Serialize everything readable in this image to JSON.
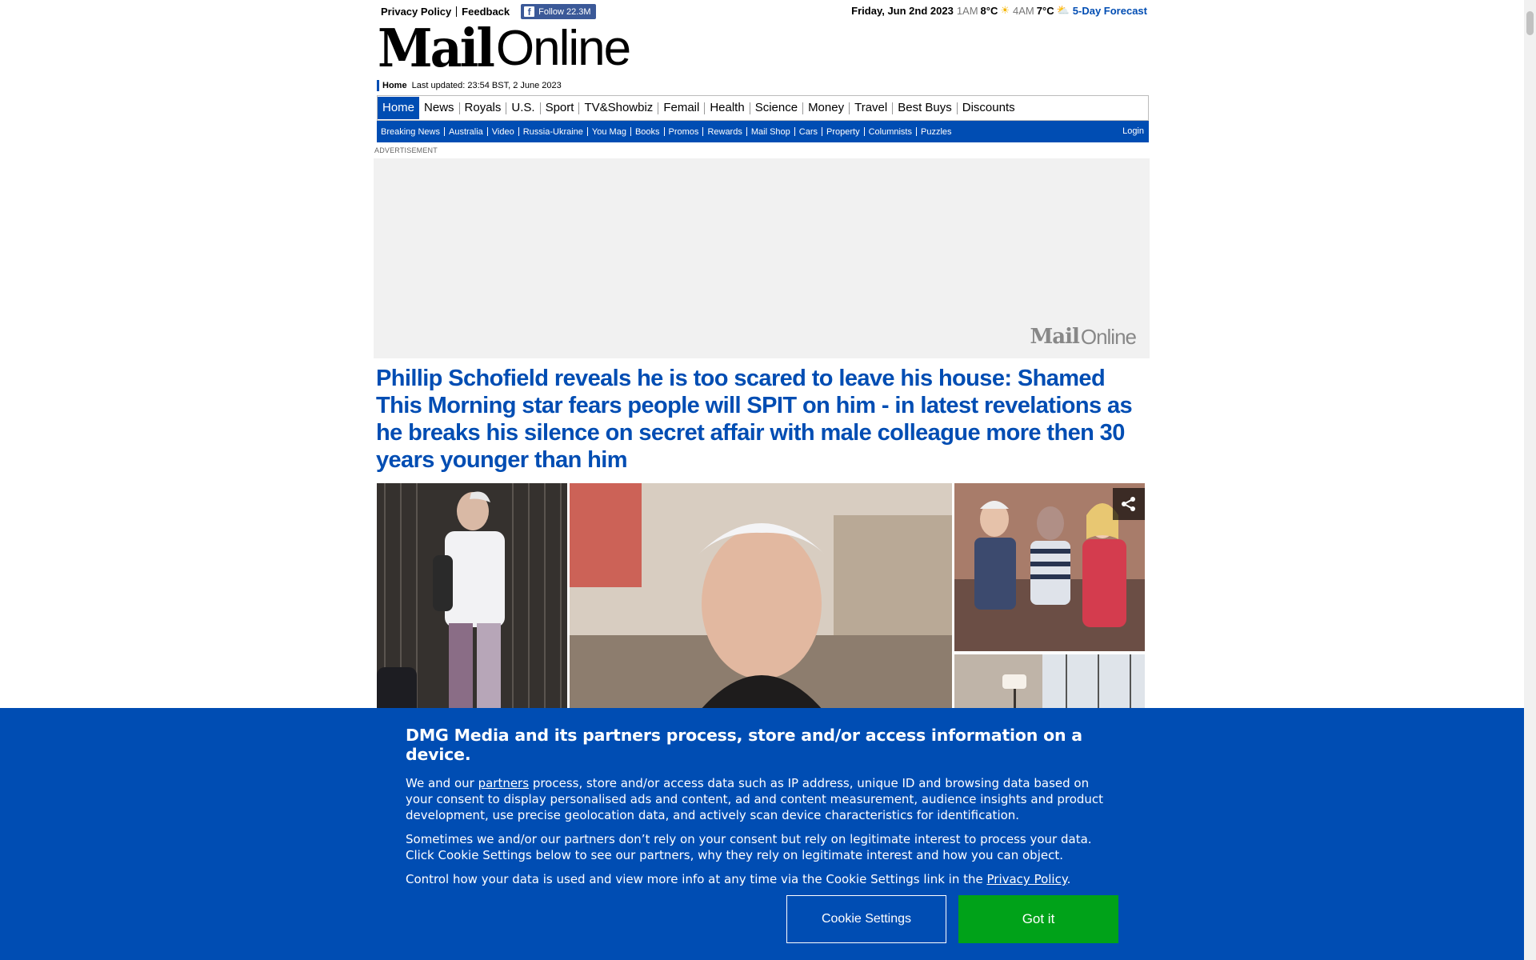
{
  "topbar": {
    "privacy_label": "Privacy Policy",
    "feedback_label": "Feedback",
    "follow_label": "Follow",
    "follow_count": "22.3M"
  },
  "weather": {
    "date": "Friday, Jun 2nd 2023",
    "time1": "1AM",
    "temp1": "8°C",
    "time2": "4AM",
    "temp2": "7°C",
    "forecast_label": "5-Day Forecast"
  },
  "logo": {
    "mail": "Mail",
    "online": "Online"
  },
  "updated": {
    "home": "Home",
    "text": "Last updated: 23:54 BST, 2 June 2023"
  },
  "nav": {
    "items": [
      "Home",
      "News",
      "Royals",
      "U.S.",
      "Sport",
      "TV&Showbiz",
      "Femail",
      "Health",
      "Science",
      "Money",
      "Travel",
      "Best Buys",
      "Discounts"
    ]
  },
  "subnav": {
    "items": [
      "Breaking News",
      "Australia",
      "Video",
      "Russia-Ukraine",
      "You Mag",
      "Books",
      "Promos",
      "Rewards",
      "Mail Shop",
      "Cars",
      "Property",
      "Columnists",
      "Puzzles"
    ],
    "login": "Login"
  },
  "ad": {
    "label": "ADVERTISEMENT"
  },
  "article": {
    "headline": "Phillip Schofield reveals he is too scared to leave his house: Shamed This Morning star fears people will SPIT on him - in latest revelations as he breaks his silence on secret affair with male colleague more then 30 years younger than him"
  },
  "consent": {
    "title": "DMG Media and its partners process, store and/or access information on a device.",
    "p1_before": "We and our ",
    "p1_link": "partners",
    "p1_after": " process, store and/or access data such as IP address, unique ID and browsing data based on your consent to display personalised ads and content, ad and content measurement, audience insights and product development, use precise geolocation data, and actively scan device characteristics for identification.",
    "p2": "Sometimes we and/or our partners don’t rely on your consent but rely on legitimate interest to process your data. Click Cookie Settings below to see our partners, why they rely on legitimate interest and how you can object.",
    "p3_before": "Control how your data is used and view more info at any time via the Cookie Settings link in the ",
    "p3_link": "Privacy Policy",
    "p3_after": ".",
    "settings_label": "Cookie Settings",
    "accept_label": "Got it"
  },
  "colors": {
    "brand_blue": "#004db3",
    "accept_green": "#00a219",
    "facebook": "#3b5998"
  },
  "icons": {
    "facebook": "facebook-icon",
    "sun": "sun-icon",
    "cloud": "partly-cloudy-icon",
    "share": "share-icon"
  }
}
